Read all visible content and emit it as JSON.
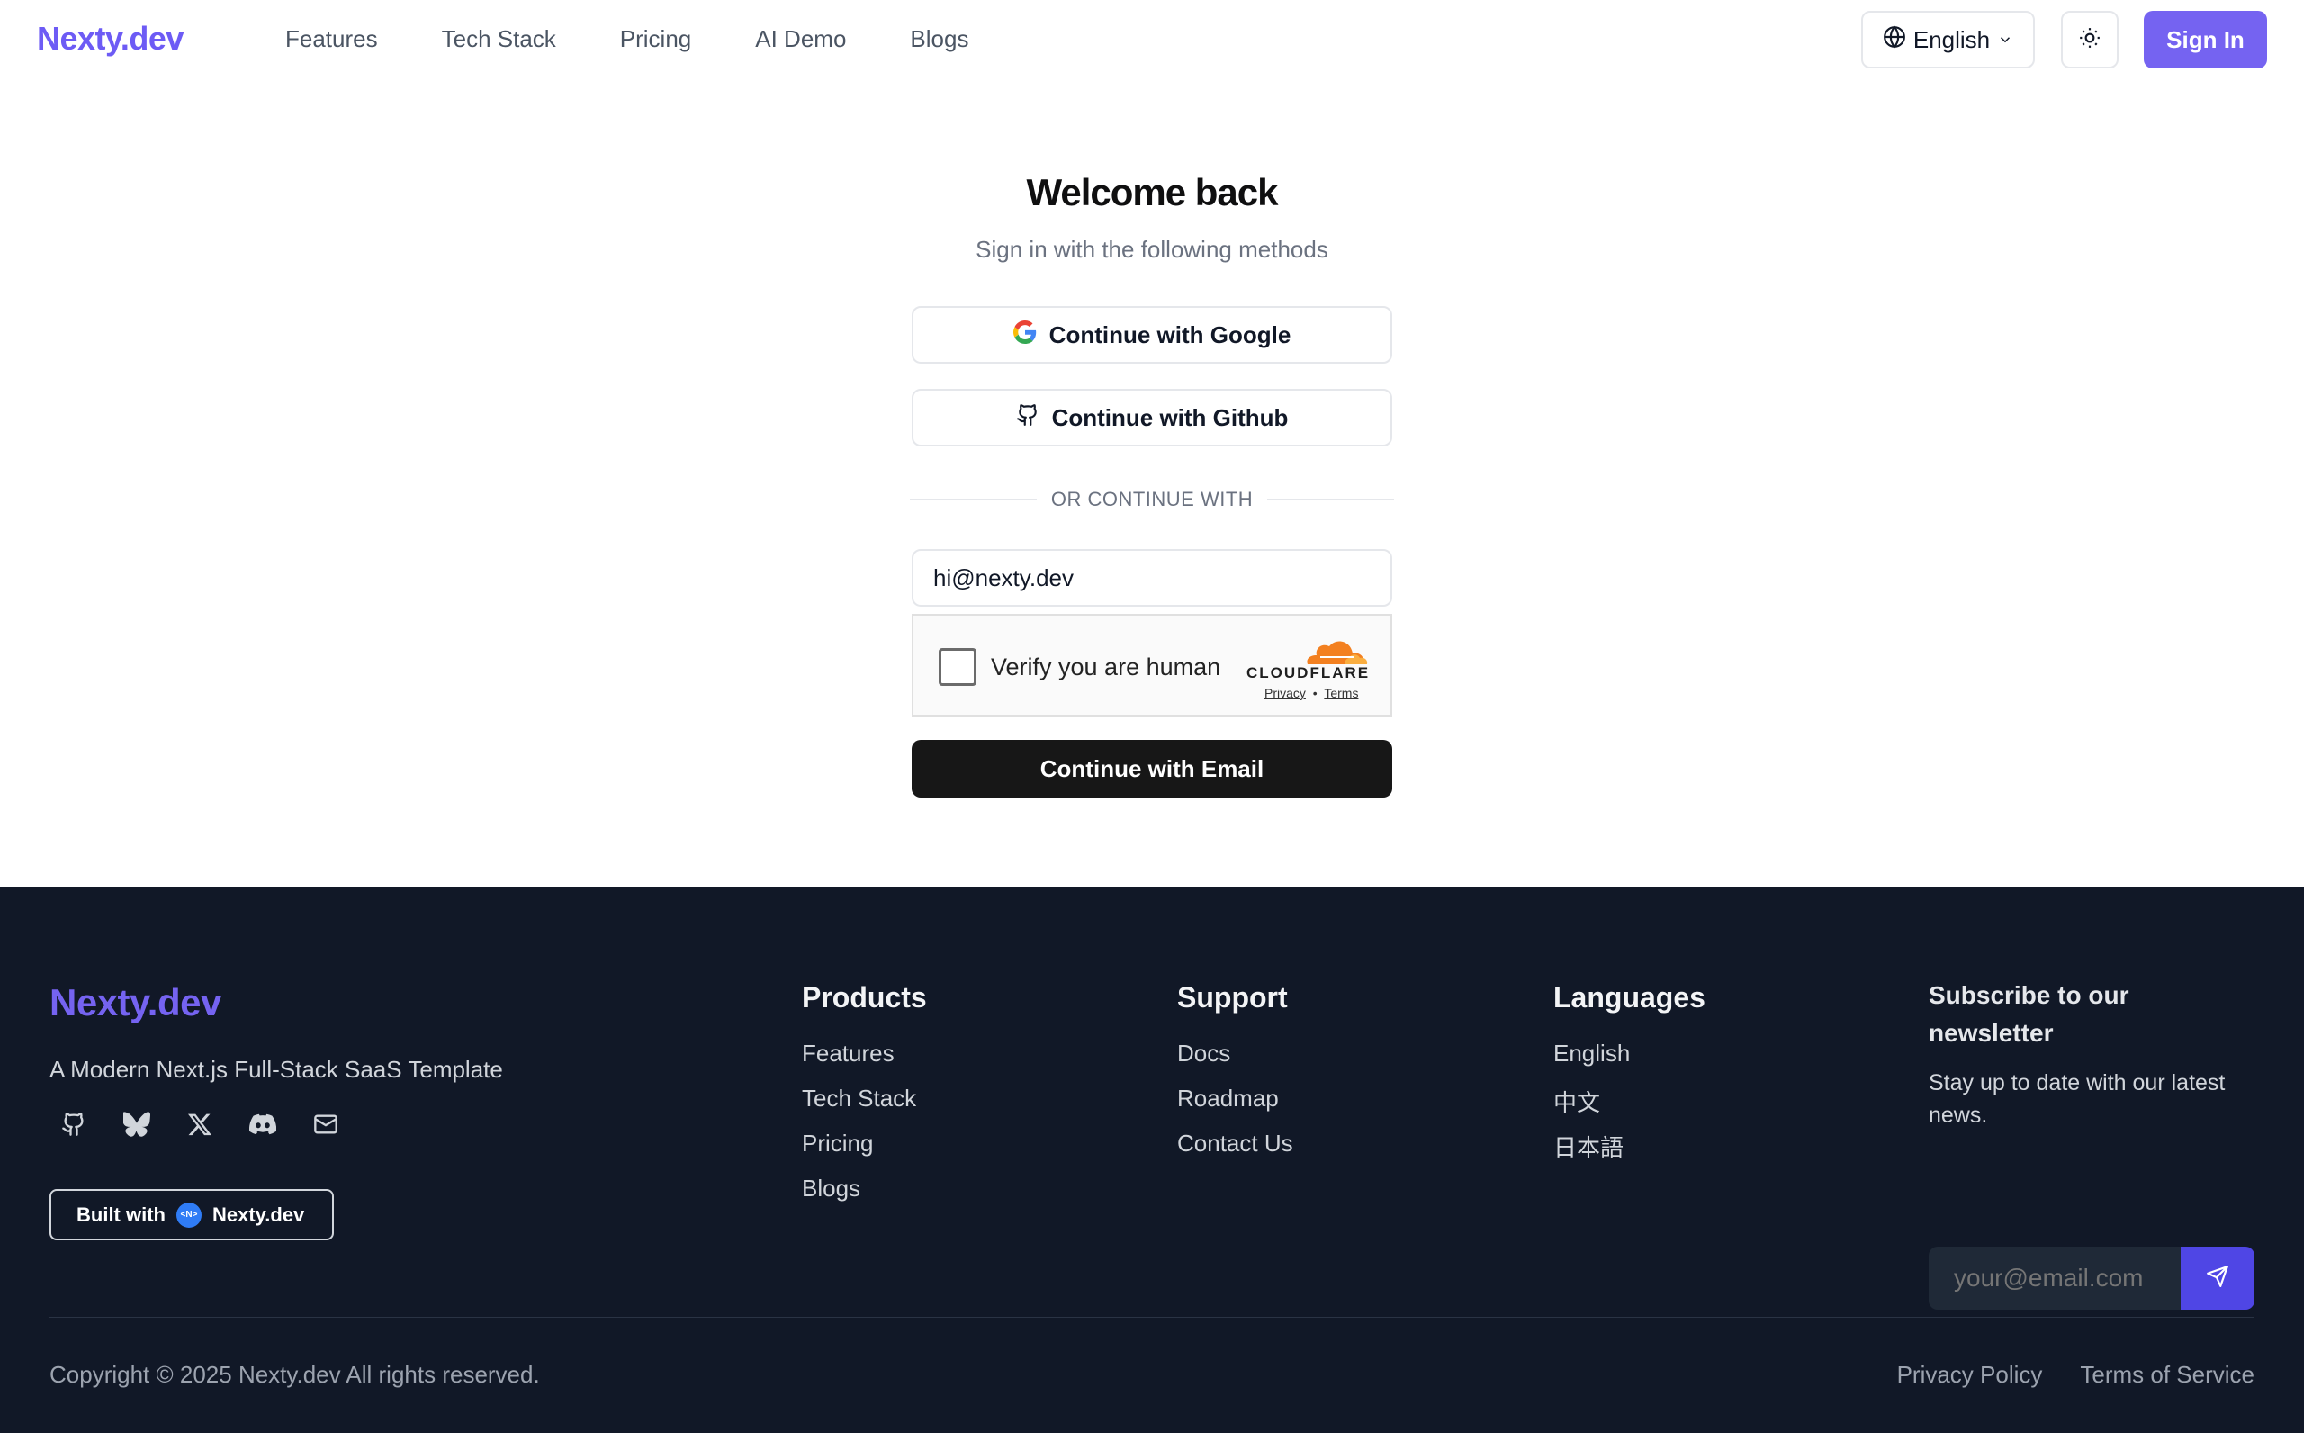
{
  "header": {
    "logo": "Nexty.dev",
    "nav": [
      "Features",
      "Tech Stack",
      "Pricing",
      "AI Demo",
      "Blogs"
    ],
    "language": "English",
    "sign_in": "Sign In"
  },
  "auth": {
    "title": "Welcome back",
    "subtitle": "Sign in with the following methods",
    "google": "Continue with Google",
    "github": "Continue with Github",
    "divider": "OR CONTINUE WITH",
    "email_value": "hi@nexty.dev",
    "captcha": {
      "label": "Verify you are human",
      "brand": "CLOUDFLARE",
      "privacy": "Privacy",
      "sep": "•",
      "terms": "Terms"
    },
    "email_button": "Continue with Email"
  },
  "footer": {
    "logo": "Nexty.dev",
    "tagline": "A Modern Next.js Full-Stack SaaS Template",
    "socials": [
      "github-icon",
      "bluesky-icon",
      "x-icon",
      "discord-icon",
      "mail-icon"
    ],
    "built_with": "Built with",
    "built_brand": "Nexty.dev",
    "products": {
      "title": "Products",
      "links": [
        "Features",
        "Tech Stack",
        "Pricing",
        "Blogs"
      ]
    },
    "support": {
      "title": "Support",
      "links": [
        "Docs",
        "Roadmap",
        "Contact Us"
      ]
    },
    "languages": {
      "title": "Languages",
      "links": [
        "English",
        "中文",
        "日本語"
      ]
    },
    "newsletter": {
      "title": "Subscribe to our newsletter",
      "text": "Stay up to date with our latest news.",
      "placeholder": "your@email.com"
    },
    "copyright": "Copyright © 2025 Nexty.dev All rights reserved.",
    "privacy": "Privacy Policy",
    "terms": "Terms of Service"
  },
  "colors": {
    "brand": "#7563f1",
    "footer_bg": "#111827",
    "primary_button": "#171717"
  }
}
